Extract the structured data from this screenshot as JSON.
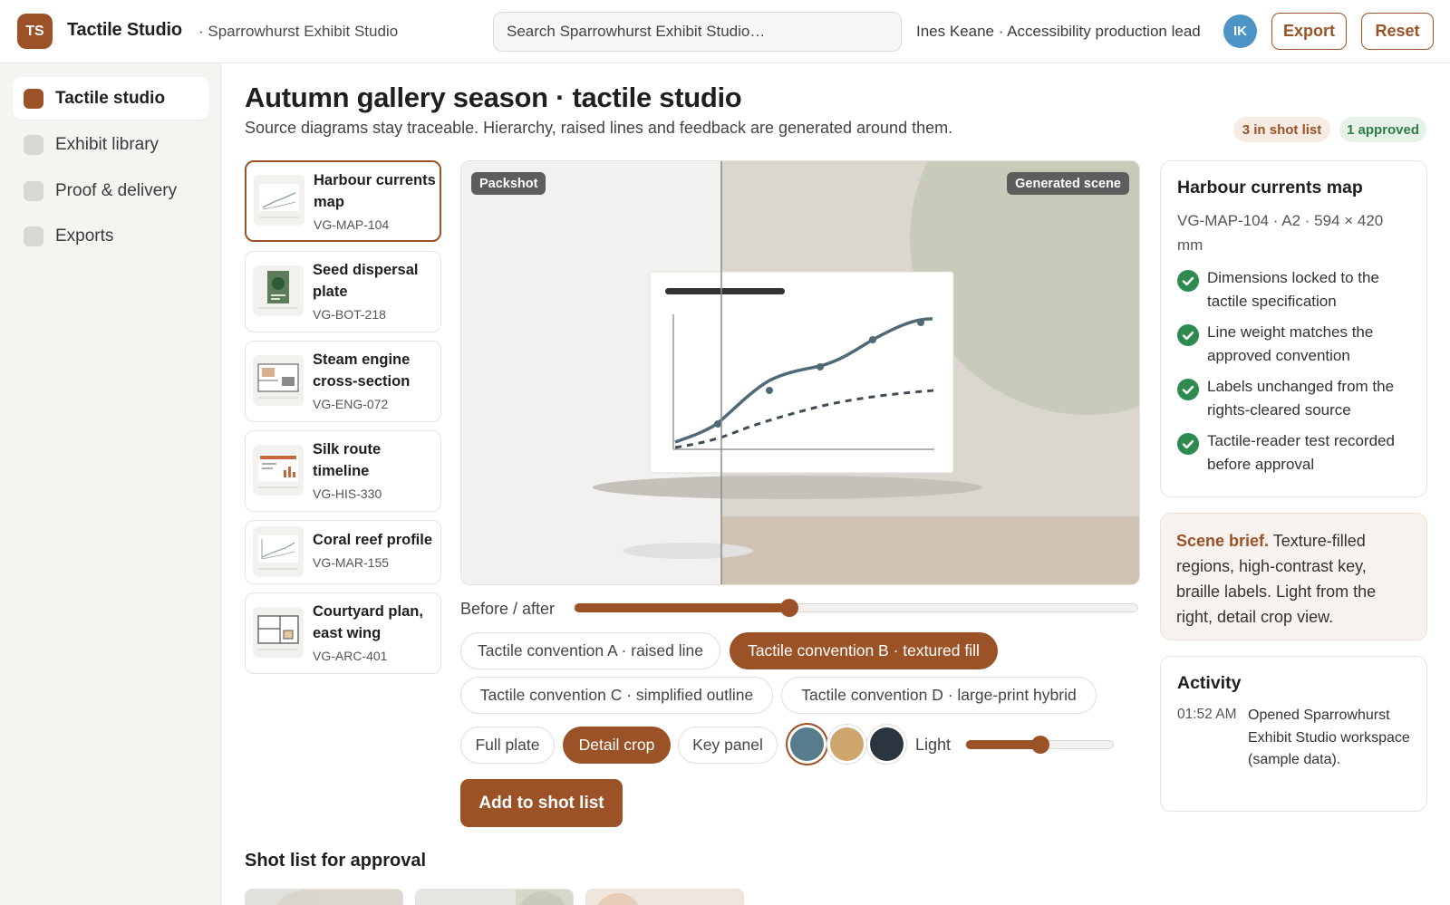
{
  "app": {
    "logo_initials": "TS",
    "title": "Tactile Studio",
    "workspace": "· Sparrowhurst Exhibit Studio"
  },
  "search": {
    "placeholder": "Search Sparrowhurst Exhibit Studio…"
  },
  "user": {
    "name": "Ines Keane · Accessibility production lead",
    "initials": "IK"
  },
  "toolbar": {
    "export_label": "Export",
    "reset_label": "Reset"
  },
  "sidebar": {
    "items": [
      {
        "label": "Tactile studio",
        "active": true
      },
      {
        "label": "Exhibit library",
        "active": false
      },
      {
        "label": "Proof & delivery",
        "active": false
      },
      {
        "label": "Exports",
        "active": false
      }
    ]
  },
  "page": {
    "title": "Autumn gallery season · tactile studio",
    "subtitle": "Source diagrams stay traceable. Hierarchy, raised lines and feedback are generated around them.",
    "badge_shotlist": "3 in shot list",
    "badge_approved": "1 approved"
  },
  "assets": [
    {
      "title": "Harbour currents map",
      "code": "VG-MAP-104",
      "thumb": "map-chart-icon"
    },
    {
      "title": "Seed dispersal plate",
      "code": "VG-BOT-218",
      "thumb": "botanical-plate-icon"
    },
    {
      "title": "Steam engine cross-section",
      "code": "VG-ENG-072",
      "thumb": "cross-section-icon"
    },
    {
      "title": "Silk route timeline",
      "code": "VG-HIS-330",
      "thumb": "timeline-icon"
    },
    {
      "title": "Coral reef profile",
      "code": "VG-MAR-155",
      "thumb": "profile-chart-icon"
    },
    {
      "title": "Courtyard plan, east wing",
      "code": "VG-ARC-401",
      "thumb": "floor-plan-icon"
    }
  ],
  "preview": {
    "before_tag": "Packshot",
    "after_tag": "Generated scene",
    "slider_label": "Before / after",
    "slider_value": 0.38
  },
  "conventions": [
    {
      "label": "Tactile convention A · raised line",
      "on": false
    },
    {
      "label": "Tactile convention B · textured fill",
      "on": true
    },
    {
      "label": "Tactile convention C · simplified outline",
      "on": false
    },
    {
      "label": "Tactile convention D · large-print hybrid",
      "on": false
    }
  ],
  "views": [
    {
      "label": "Full plate",
      "on": false
    },
    {
      "label": "Detail crop",
      "on": true
    },
    {
      "label": "Key panel",
      "on": false
    }
  ],
  "swatches": [
    {
      "color": "#587c8c",
      "selected": true
    },
    {
      "color": "#cfa56e",
      "selected": false
    },
    {
      "color": "#2b3540",
      "selected": false
    }
  ],
  "light": {
    "label": "Light",
    "value": 0.5
  },
  "actions": {
    "add_to_shotlist": "Add to shot list"
  },
  "shotlist": {
    "title": "Shot list for approval"
  },
  "detail": {
    "title": "Harbour currents map",
    "meta": "VG-MAP-104 · A2 · 594 × 420 mm",
    "checks": [
      "Dimensions locked to the tactile specification",
      "Line weight matches the approved convention",
      "Labels unchanged from the rights-cleared source",
      "Tactile-reader test recorded before approval"
    ]
  },
  "brief": {
    "lead": "Scene brief.",
    "text": " Texture-filled regions, high-contrast key, braille labels. Light from the right, detail crop view."
  },
  "activity": {
    "title": "Activity",
    "entries": [
      {
        "time": "01:52 AM",
        "text": "Opened Sparrowhurst Exhibit Studio workspace (sample data)."
      }
    ]
  },
  "colors": {
    "accent": "#9a5226",
    "success": "#2e8b4f",
    "avatar": "#4c94c6"
  }
}
